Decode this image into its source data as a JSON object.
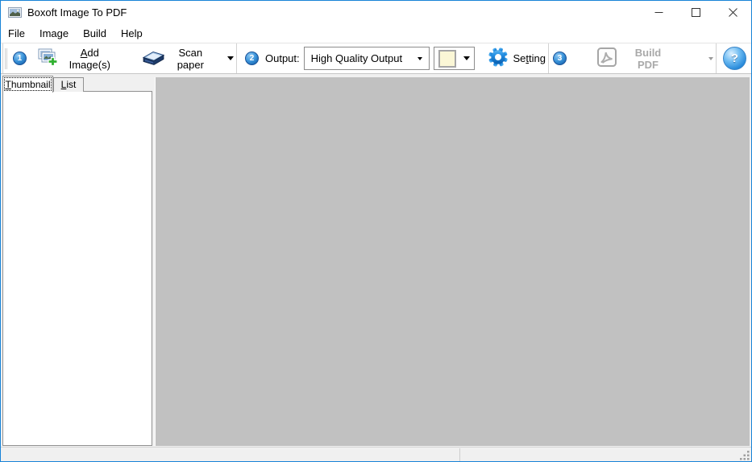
{
  "titlebar": {
    "title": "Boxoft Image To PDF"
  },
  "menubar": {
    "items": [
      {
        "label": "File"
      },
      {
        "label": "Image"
      },
      {
        "label": "Build"
      },
      {
        "label": "Help"
      }
    ]
  },
  "toolbar": {
    "step1_badge": "1",
    "add_images": {
      "pre": "",
      "accel": "A",
      "post": "dd Image(s)"
    },
    "scan_paper": {
      "label": "Scan paper"
    },
    "step2_badge": "2",
    "output_label": "Output:",
    "output_quality": {
      "value": "High Quality Output"
    },
    "color_picker": {
      "swatch_style": "background:#FBF7D6"
    },
    "setting": {
      "pre": "Se",
      "accel": "t",
      "post": "ting"
    },
    "step3_badge": "3",
    "build_pdf": {
      "label": "Build PDF"
    },
    "help": {
      "label": "?"
    }
  },
  "sidebar": {
    "tabs": [
      {
        "pre": "",
        "accel": "T",
        "post": "humbnail",
        "active": true
      },
      {
        "pre": "",
        "accel": "L",
        "post": "ist",
        "active": false
      }
    ]
  },
  "colors": {
    "accent_border": "#1883d7",
    "workspace_background": "#c1c1c1",
    "statusbar_background": "#f0f0f0",
    "step_badge_blue": "#2e8bd8",
    "color_swatch": "#FBF7D6"
  }
}
